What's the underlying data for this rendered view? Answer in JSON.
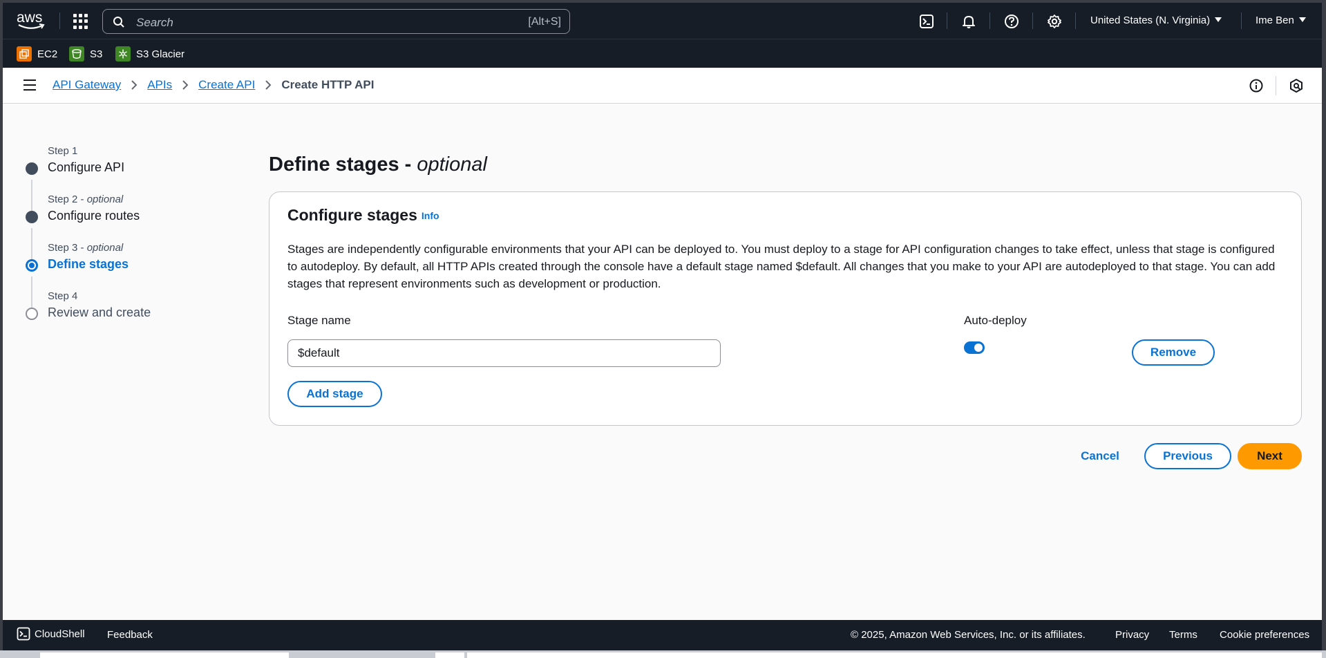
{
  "topnav": {
    "logo_text": "aws",
    "search_placeholder": "Search",
    "search_shortcut": "[Alt+S]",
    "region": "United States (N. Virginia)",
    "user": "Ime Ben",
    "icons": [
      "grid-icon",
      "search-icon",
      "cloudshell-icon",
      "bell-icon",
      "help-icon",
      "gear-icon"
    ]
  },
  "favorites": [
    {
      "label": "EC2",
      "color": "#ed7100"
    },
    {
      "label": "S3",
      "color": "#3f8624"
    },
    {
      "label": "S3 Glacier",
      "color": "#3f8624"
    }
  ],
  "breadcrumb": {
    "items": [
      "API Gateway",
      "APIs",
      "Create API"
    ],
    "current": "Create HTTP API"
  },
  "steps": [
    {
      "label": "Step 1",
      "optional": "",
      "name": "Configure API",
      "state": "complete"
    },
    {
      "label": "Step 2 - ",
      "optional": "optional",
      "name": "Configure routes",
      "state": "complete"
    },
    {
      "label": "Step 3 - ",
      "optional": "optional",
      "name": "Define stages",
      "state": "active"
    },
    {
      "label": "Step 4",
      "optional": "",
      "name": "Review and create",
      "state": "pending"
    }
  ],
  "page": {
    "title": "Define stages - ",
    "title_italic": "optional"
  },
  "card": {
    "title": "Configure stages",
    "info_link": "Info",
    "description": "Stages are independently configurable environments that your API can be deployed to. You must deploy to a stage for API configuration changes to take effect, unless that stage is configured to autodeploy. By default, all HTTP APIs created through the console have a default stage named $default. All changes that you make to your API are autodeployed to that stage. You can add stages that represent environments such as development or production.",
    "stage_name_label": "Stage name",
    "stage_name_value": "$default",
    "auto_deploy_label": "Auto-deploy",
    "auto_deploy_on": true,
    "remove_button": "Remove",
    "add_stage_button": "Add stage"
  },
  "actions": {
    "cancel": "Cancel",
    "previous": "Previous",
    "next": "Next"
  },
  "footer": {
    "cloudshell": "CloudShell",
    "feedback": "Feedback",
    "copyright": "© 2025, Amazon Web Services, Inc. or its affiliates.",
    "privacy": "Privacy",
    "terms": "Terms",
    "cookie": "Cookie preferences"
  },
  "colors": {
    "nav_bg": "#161d26",
    "link": "#0972d3",
    "primary_button": "#ff9900",
    "step_complete": "#414d5c"
  }
}
